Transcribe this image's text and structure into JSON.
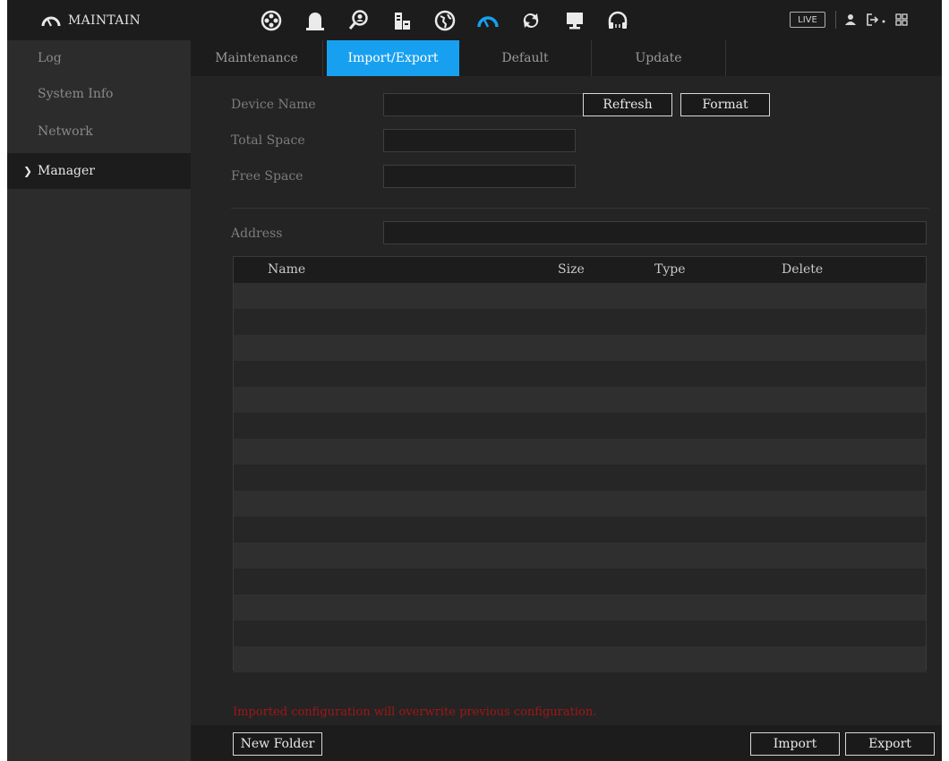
{
  "header": {
    "title": "MAINTAIN",
    "live_label": "LIVE",
    "menu_icons": [
      "camera-reel-icon",
      "alarm-bell-icon",
      "search-person-icon",
      "storage-icon",
      "network-globe-icon",
      "maintain-gauge-icon",
      "backup-sync-icon",
      "display-monitor-icon",
      "audio-headset-icon"
    ],
    "active_menu": "maintain-gauge-icon",
    "right_icons": [
      "user-icon",
      "logout-icon",
      "grid-icon"
    ],
    "accent_color": "#18a0f0"
  },
  "sidebar": {
    "items": [
      {
        "label": "Log"
      },
      {
        "label": "System Info"
      },
      {
        "label": "Network"
      },
      {
        "label": "Manager",
        "active": true
      }
    ]
  },
  "tabs": [
    {
      "label": "Maintenance"
    },
    {
      "label": "Import/Export",
      "active": true
    },
    {
      "label": "Default"
    },
    {
      "label": "Update"
    }
  ],
  "form": {
    "device_name_label": "Device Name",
    "device_name_value": "",
    "total_space_label": "Total Space",
    "total_space_value": "",
    "free_space_label": "Free Space",
    "free_space_value": "",
    "refresh_label": "Refresh",
    "format_label": "Format",
    "address_label": "Address",
    "address_value": ""
  },
  "table": {
    "columns": [
      "Name",
      "Size",
      "Type",
      "Delete"
    ],
    "rows": []
  },
  "warning": "Imported configuration will overwrite previous configuration.",
  "footer": {
    "new_folder_label": "New Folder",
    "import_label": "Import",
    "export_label": "Export"
  }
}
